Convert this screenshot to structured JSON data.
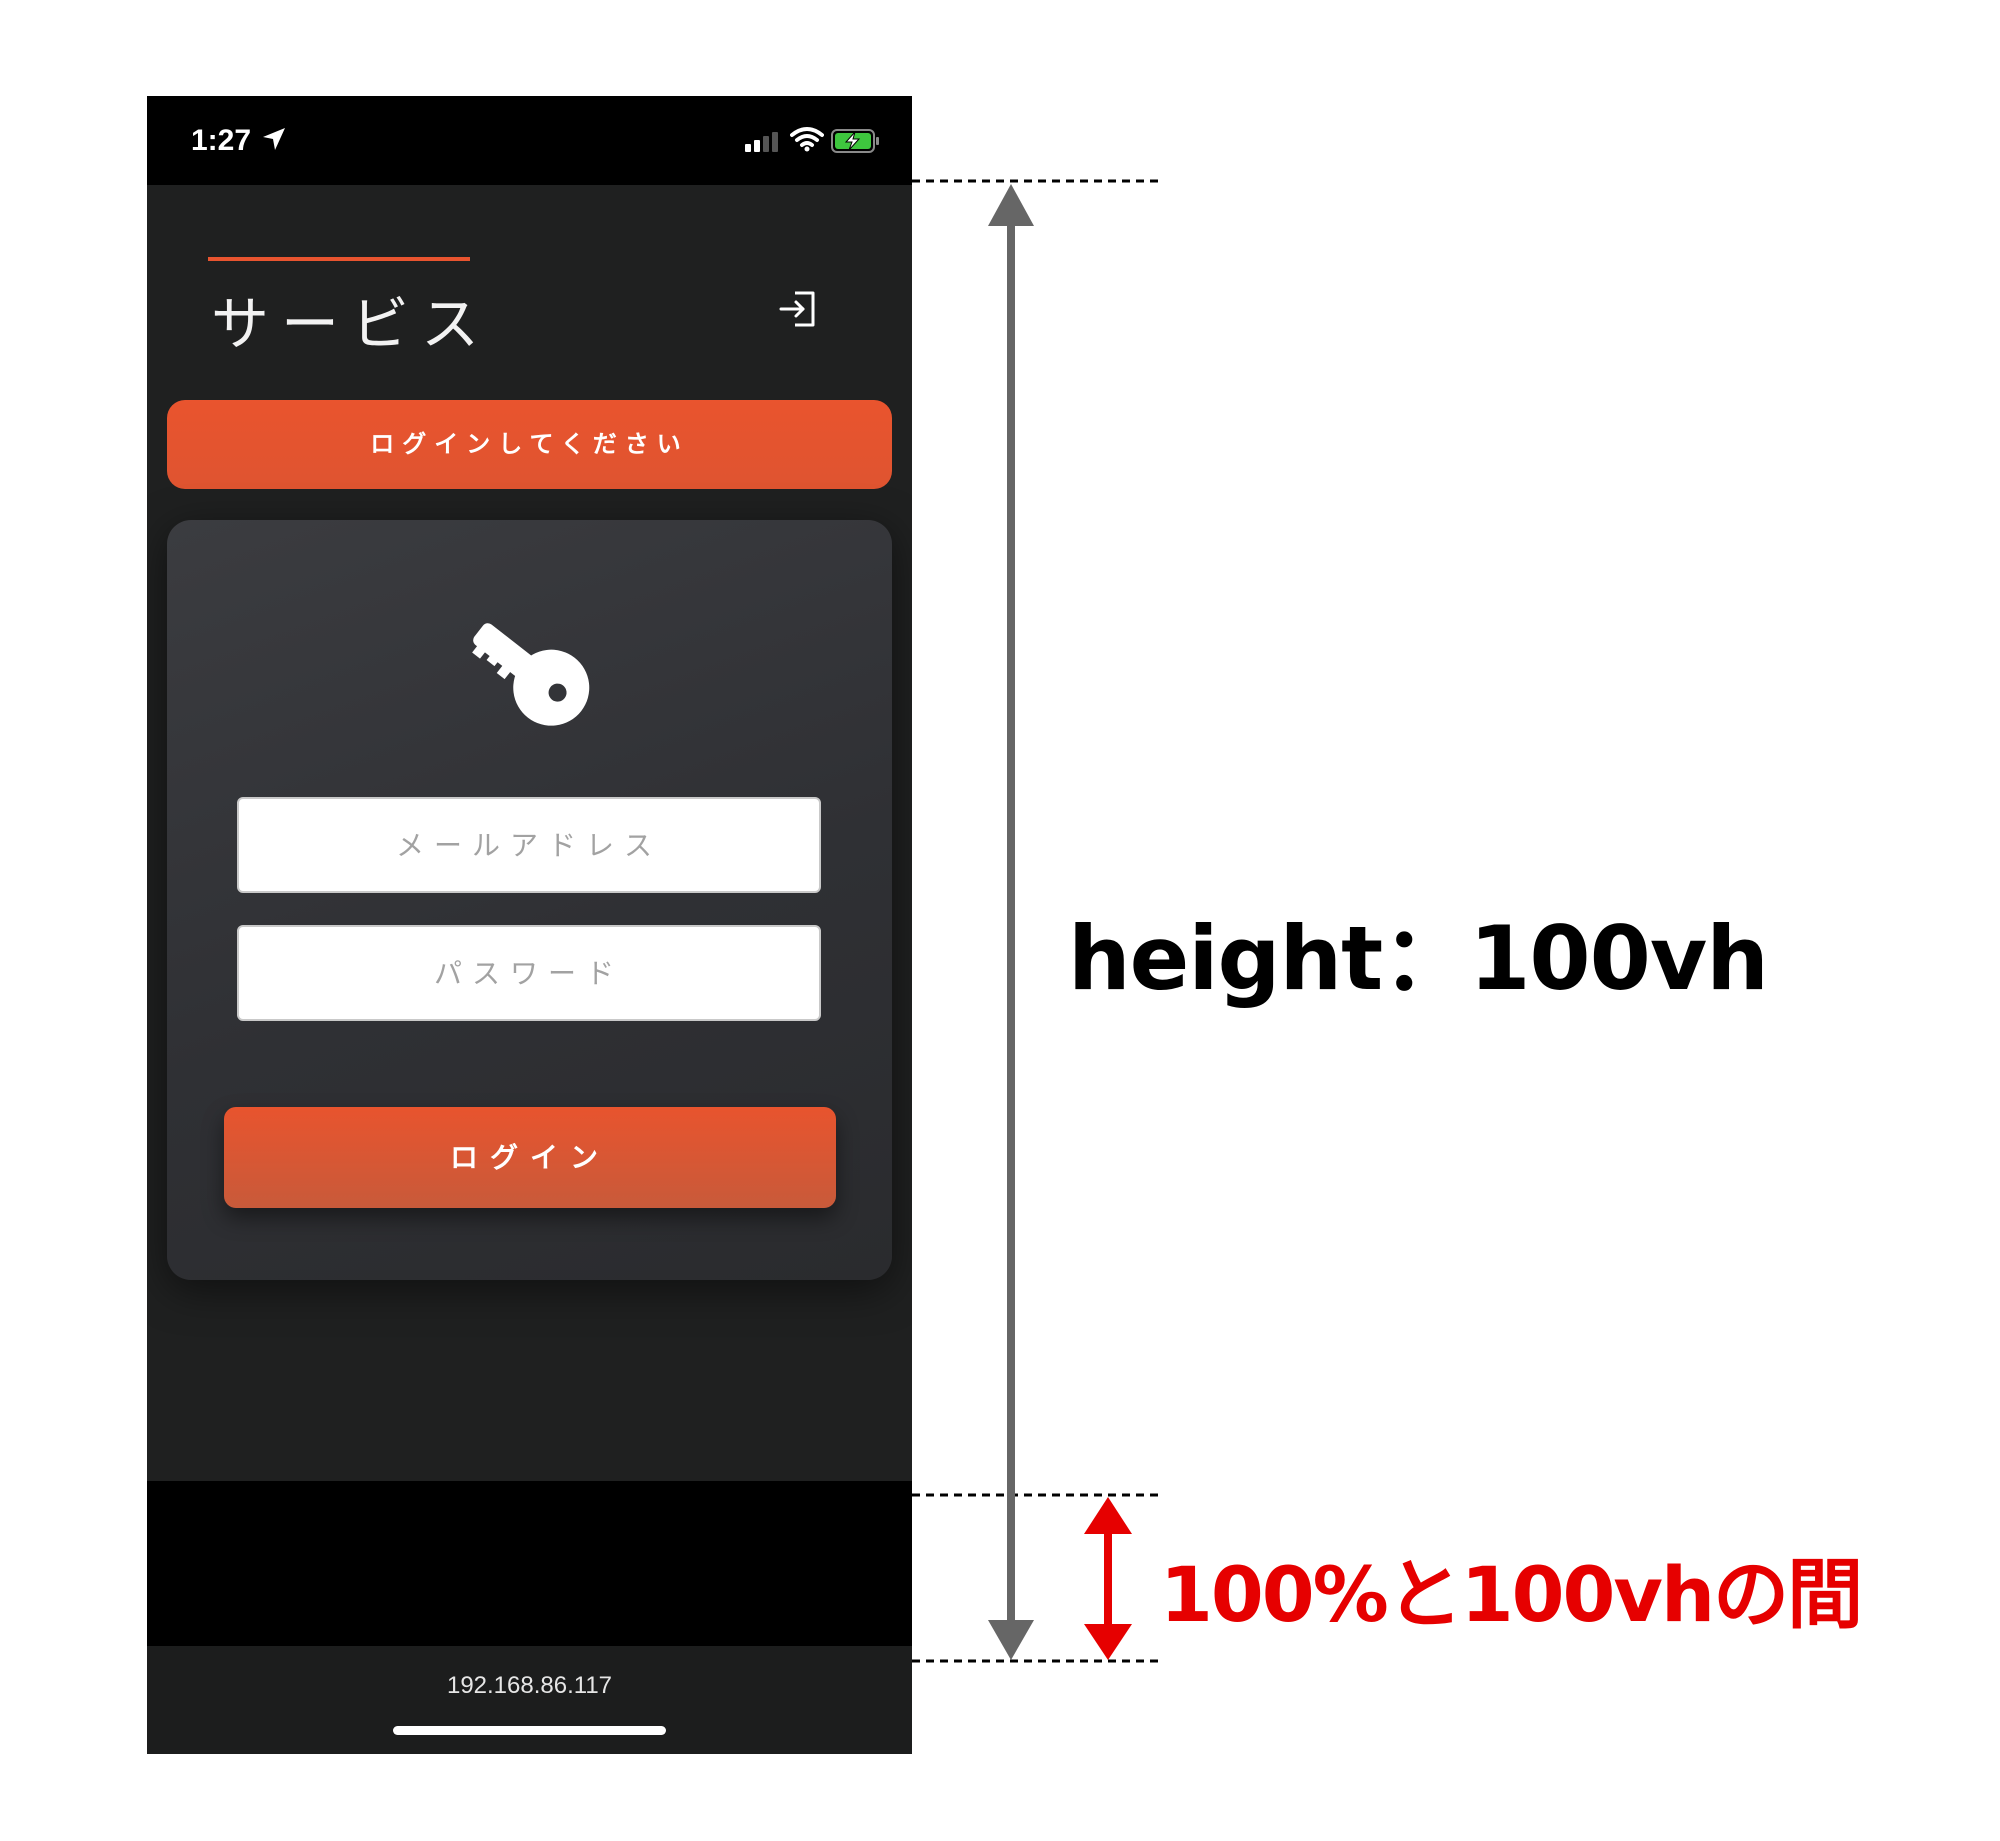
{
  "status_bar": {
    "time": "1:27",
    "icons": [
      "location-arrow-icon",
      "cellular-signal-icon",
      "wifi-icon",
      "battery-charging-icon"
    ]
  },
  "header": {
    "title": "サービス",
    "logout_icon": "logout-icon"
  },
  "banner": {
    "text": "ログインしてください"
  },
  "login_card": {
    "icon": "key-icon",
    "email": {
      "placeholder": "メールアドレス",
      "value": ""
    },
    "password": {
      "placeholder": "パスワード",
      "value": ""
    },
    "submit_label": "ログイン"
  },
  "browser": {
    "url": "192.168.86.117"
  },
  "annotations": {
    "height_label": "height：100vh",
    "gap_label": "100%と100vhの間"
  },
  "colors": {
    "accent": "#e8542f",
    "background": "#1f2020",
    "card": "#333438",
    "annotation_red": "#e60000",
    "annotation_gray": "#666666"
  }
}
